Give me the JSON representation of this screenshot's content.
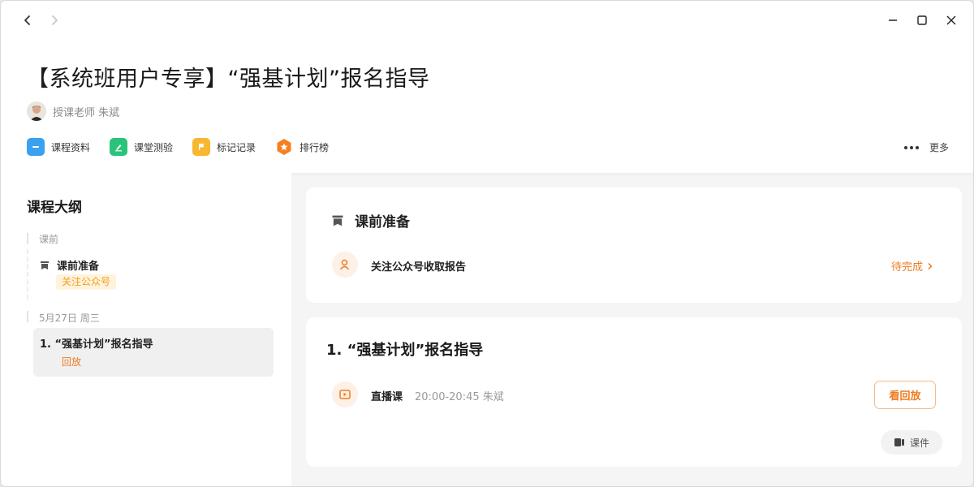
{
  "window": {
    "title": "【系统班用户专享】“强基计划”报名指导",
    "teacher": "授课老师 朱斌"
  },
  "toolbar": {
    "items": [
      {
        "label": "课程资料",
        "icon": "folder-icon",
        "color": "#3aa0f0"
      },
      {
        "label": "课堂测验",
        "icon": "pencil-icon",
        "color": "#2bc37a"
      },
      {
        "label": "标记记录",
        "icon": "flag-icon",
        "color": "#f7b731"
      },
      {
        "label": "排行榜",
        "icon": "badge-icon",
        "color": "#f77f1f"
      }
    ],
    "more_label": "更多"
  },
  "sidebar": {
    "title": "课程大纲",
    "section1": "课前",
    "item1_title": "课前准备",
    "item1_tag": "关注公众号",
    "section2": "5月27日 周三",
    "item2_title": "1.  “强基计划”报名指导",
    "item2_tag": "回放"
  },
  "card1": {
    "title": "课前准备",
    "row_text": "关注公众号收取报告",
    "status": "待完成"
  },
  "card2": {
    "title": "1.  “强基计划”报名指导",
    "type": "直播课",
    "meta": "20:00-20:45  朱斌",
    "replay": "看回放",
    "courseware": "课件"
  },
  "colors": {
    "accent": "#f07a1f"
  }
}
